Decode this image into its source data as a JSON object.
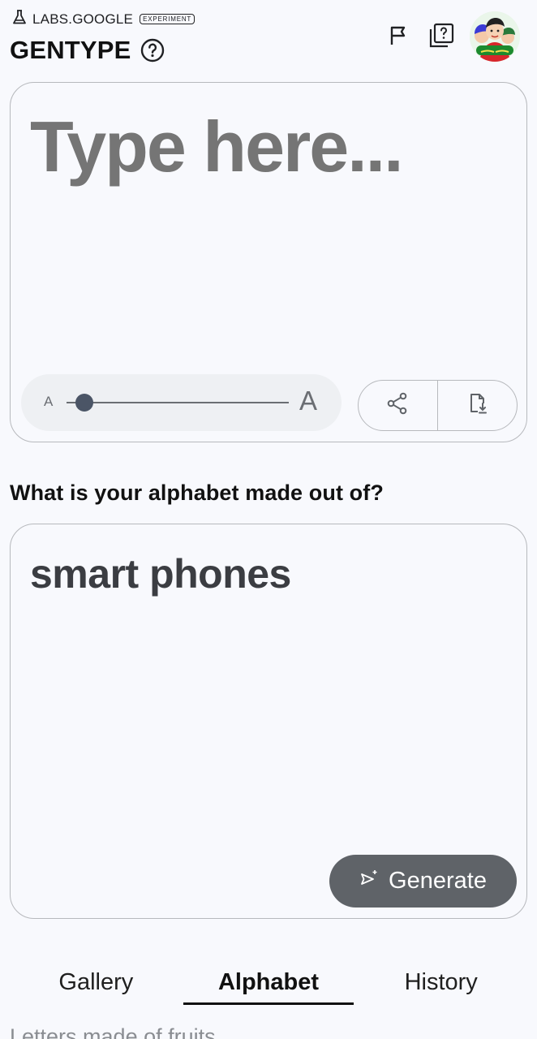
{
  "header": {
    "brand": "LABS.GOOGLE",
    "badge": "EXPERIMENT",
    "title": "GENTYPE",
    "icons": [
      "flask-icon",
      "help-circle-icon",
      "flag-icon",
      "help-grid-icon",
      "avatar"
    ]
  },
  "type_card": {
    "placeholder": "Type here...",
    "size_small_label": "A",
    "size_large_label": "A",
    "slider_level": 0.08,
    "actions": [
      "share-icon",
      "download-file-icon"
    ]
  },
  "question": "What is your alphabet made out of?",
  "prompt_card": {
    "value": "smart phones",
    "generate_label": "Generate"
  },
  "tabs": [
    {
      "label": "Gallery",
      "active": false
    },
    {
      "label": "Alphabet",
      "active": true
    },
    {
      "label": "History",
      "active": false
    }
  ],
  "peek_text": "Letters made of fruits"
}
